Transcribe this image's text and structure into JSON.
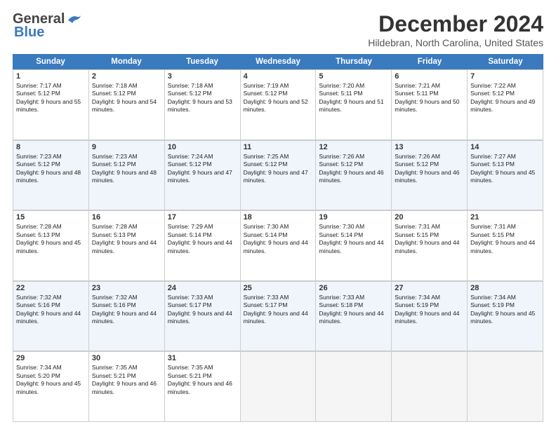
{
  "logo": {
    "general": "General",
    "blue": "Blue"
  },
  "title": "December 2024",
  "location": "Hildebran, North Carolina, United States",
  "days_of_week": [
    "Sunday",
    "Monday",
    "Tuesday",
    "Wednesday",
    "Thursday",
    "Friday",
    "Saturday"
  ],
  "weeks": [
    [
      {
        "day": "1",
        "sunrise": "7:17 AM",
        "sunset": "5:12 PM",
        "daylight": "9 hours and 55 minutes."
      },
      {
        "day": "2",
        "sunrise": "7:18 AM",
        "sunset": "5:12 PM",
        "daylight": "9 hours and 54 minutes."
      },
      {
        "day": "3",
        "sunrise": "7:18 AM",
        "sunset": "5:12 PM",
        "daylight": "9 hours and 53 minutes."
      },
      {
        "day": "4",
        "sunrise": "7:19 AM",
        "sunset": "5:12 PM",
        "daylight": "9 hours and 52 minutes."
      },
      {
        "day": "5",
        "sunrise": "7:20 AM",
        "sunset": "5:11 PM",
        "daylight": "9 hours and 51 minutes."
      },
      {
        "day": "6",
        "sunrise": "7:21 AM",
        "sunset": "5:11 PM",
        "daylight": "9 hours and 50 minutes."
      },
      {
        "day": "7",
        "sunrise": "7:22 AM",
        "sunset": "5:12 PM",
        "daylight": "9 hours and 49 minutes."
      }
    ],
    [
      {
        "day": "8",
        "sunrise": "7:23 AM",
        "sunset": "5:12 PM",
        "daylight": "9 hours and 48 minutes."
      },
      {
        "day": "9",
        "sunrise": "7:23 AM",
        "sunset": "5:12 PM",
        "daylight": "9 hours and 48 minutes."
      },
      {
        "day": "10",
        "sunrise": "7:24 AM",
        "sunset": "5:12 PM",
        "daylight": "9 hours and 47 minutes."
      },
      {
        "day": "11",
        "sunrise": "7:25 AM",
        "sunset": "5:12 PM",
        "daylight": "9 hours and 47 minutes."
      },
      {
        "day": "12",
        "sunrise": "7:26 AM",
        "sunset": "5:12 PM",
        "daylight": "9 hours and 46 minutes."
      },
      {
        "day": "13",
        "sunrise": "7:26 AM",
        "sunset": "5:12 PM",
        "daylight": "9 hours and 46 minutes."
      },
      {
        "day": "14",
        "sunrise": "7:27 AM",
        "sunset": "5:13 PM",
        "daylight": "9 hours and 45 minutes."
      }
    ],
    [
      {
        "day": "15",
        "sunrise": "7:28 AM",
        "sunset": "5:13 PM",
        "daylight": "9 hours and 45 minutes."
      },
      {
        "day": "16",
        "sunrise": "7:28 AM",
        "sunset": "5:13 PM",
        "daylight": "9 hours and 44 minutes."
      },
      {
        "day": "17",
        "sunrise": "7:29 AM",
        "sunset": "5:14 PM",
        "daylight": "9 hours and 44 minutes."
      },
      {
        "day": "18",
        "sunrise": "7:30 AM",
        "sunset": "5:14 PM",
        "daylight": "9 hours and 44 minutes."
      },
      {
        "day": "19",
        "sunrise": "7:30 AM",
        "sunset": "5:14 PM",
        "daylight": "9 hours and 44 minutes."
      },
      {
        "day": "20",
        "sunrise": "7:31 AM",
        "sunset": "5:15 PM",
        "daylight": "9 hours and 44 minutes."
      },
      {
        "day": "21",
        "sunrise": "7:31 AM",
        "sunset": "5:15 PM",
        "daylight": "9 hours and 44 minutes."
      }
    ],
    [
      {
        "day": "22",
        "sunrise": "7:32 AM",
        "sunset": "5:16 PM",
        "daylight": "9 hours and 44 minutes."
      },
      {
        "day": "23",
        "sunrise": "7:32 AM",
        "sunset": "5:16 PM",
        "daylight": "9 hours and 44 minutes."
      },
      {
        "day": "24",
        "sunrise": "7:33 AM",
        "sunset": "5:17 PM",
        "daylight": "9 hours and 44 minutes."
      },
      {
        "day": "25",
        "sunrise": "7:33 AM",
        "sunset": "5:17 PM",
        "daylight": "9 hours and 44 minutes."
      },
      {
        "day": "26",
        "sunrise": "7:33 AM",
        "sunset": "5:18 PM",
        "daylight": "9 hours and 44 minutes."
      },
      {
        "day": "27",
        "sunrise": "7:34 AM",
        "sunset": "5:19 PM",
        "daylight": "9 hours and 44 minutes."
      },
      {
        "day": "28",
        "sunrise": "7:34 AM",
        "sunset": "5:19 PM",
        "daylight": "9 hours and 45 minutes."
      }
    ],
    [
      {
        "day": "29",
        "sunrise": "7:34 AM",
        "sunset": "5:20 PM",
        "daylight": "9 hours and 45 minutes."
      },
      {
        "day": "30",
        "sunrise": "7:35 AM",
        "sunset": "5:21 PM",
        "daylight": "9 hours and 46 minutes."
      },
      {
        "day": "31",
        "sunrise": "7:35 AM",
        "sunset": "5:21 PM",
        "daylight": "9 hours and 46 minutes."
      },
      {
        "day": "",
        "sunrise": "",
        "sunset": "",
        "daylight": ""
      },
      {
        "day": "",
        "sunrise": "",
        "sunset": "",
        "daylight": ""
      },
      {
        "day": "",
        "sunrise": "",
        "sunset": "",
        "daylight": ""
      },
      {
        "day": "",
        "sunrise": "",
        "sunset": "",
        "daylight": ""
      }
    ]
  ]
}
